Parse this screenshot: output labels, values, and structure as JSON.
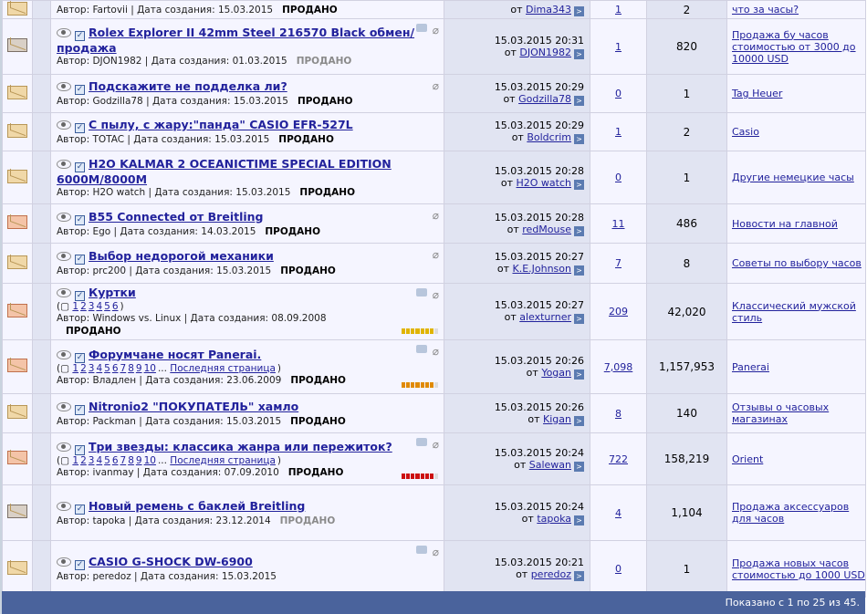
{
  "rows": [
    {
      "icon": "env",
      "title": "",
      "pages": null,
      "author": "Автор: Fartovii | Дата создания: 15.03.2015",
      "sold": "ПРОДАНО",
      "sold_grey": false,
      "date": "",
      "by": "от",
      "user": "Dima343",
      "replies": "1",
      "views": "2",
      "forum": "что за часы?",
      "h": 20,
      "rating": null
    },
    {
      "icon": "locked",
      "title": "Rolex Explorer II 42mm Steel 216570 Black обмен/продажа",
      "pages": null,
      "author": "Автор: DJON1982 | Дата создания: 01.03.2015",
      "sold": "ПРОДАНО",
      "sold_grey": true,
      "date": "15.03.2015 20:31",
      "by": "от",
      "user": "DJON1982",
      "replies": "1",
      "views": "820",
      "forum": "Продажа бу часов стоимостью от 3000 до 10000 USD",
      "h": 61,
      "rating": null,
      "tag": true
    },
    {
      "icon": "env",
      "title": "Подскажите не подделка ли?",
      "pages": null,
      "author": "Автор: Godzilla78 | Дата создания: 15.03.2015",
      "sold": "ПРОДАНО",
      "sold_grey": false,
      "date": "15.03.2015 20:29",
      "by": "от",
      "user": "Godzilla78",
      "replies": "0",
      "views": "1",
      "forum": "Tag Heuer",
      "h": 42,
      "rating": null
    },
    {
      "icon": "env",
      "title": "С пылу, с жару:\"панда\" CASIO EFR-527L",
      "pages": null,
      "author": "Автор: TOTAC | Дата создания: 15.03.2015",
      "sold": "ПРОДАНО",
      "sold_grey": false,
      "date": "15.03.2015 20:29",
      "by": "от",
      "user": "Boldcrim",
      "replies": "1",
      "views": "2",
      "forum": "Casio",
      "h": 42,
      "rating": null
    },
    {
      "icon": "env",
      "title": "H2O KALMAR 2 OCEANICTIME SPECIAL EDITION 6000M/8000M",
      "pages": null,
      "author": "Автор: H2O watch | Дата создания: 15.03.2015",
      "sold": "ПРОДАНО",
      "sold_grey": false,
      "date": "15.03.2015 20:28",
      "by": "от",
      "user": "H2O watch",
      "replies": "0",
      "views": "1",
      "forum": "Другие немецкие часы",
      "h": 58,
      "rating": null
    },
    {
      "icon": "hot",
      "title": "B55 Connected от Breitling",
      "pages": null,
      "author": "Автор: Ego | Дата создания: 14.03.2015",
      "sold": "ПРОДАНО",
      "sold_grey": false,
      "date": "15.03.2015 20:28",
      "by": "от",
      "user": "redMouse",
      "replies": "11",
      "views": "486",
      "forum": "Новости на главной",
      "h": 43,
      "rating": null
    },
    {
      "icon": "env",
      "title": "Выбор недорогой механики",
      "pages": null,
      "author": "Автор: prc200 | Дата создания: 15.03.2015",
      "sold": "ПРОДАНО",
      "sold_grey": false,
      "date": "15.03.2015 20:27",
      "by": "от",
      "user": "K.E.Johnson",
      "replies": "7",
      "views": "8",
      "forum": "Советы по выбору часов",
      "h": 44,
      "rating": null
    },
    {
      "icon": "hot",
      "title": "Куртки",
      "pages": [
        "1",
        "2",
        "3",
        "4",
        "5",
        "6"
      ],
      "pages_last": null,
      "author": "Автор: Windows vs. Linux | Дата создания: 08.09.2008",
      "sold": "ПРОДАНО",
      "sold_grey": false,
      "sold_newline": true,
      "date": "15.03.2015 20:27",
      "by": "от",
      "user": "alexturner",
      "replies": "209",
      "views": "42,020",
      "forum": "Классический мужской стиль",
      "h": 56,
      "rating": "yellow",
      "tag": true
    },
    {
      "icon": "hot",
      "title": "Форумчане носят Panerai.",
      "pages": [
        "1",
        "2",
        "3",
        "4",
        "5",
        "6",
        "7",
        "8",
        "9",
        "10"
      ],
      "pages_last": "Последняя страница",
      "author": "Автор: Владлен | Дата создания: 23.06.2009",
      "sold": "ПРОДАНО",
      "sold_grey": false,
      "date": "15.03.2015 20:26",
      "by": "от",
      "user": "Yogan",
      "replies": "7,098",
      "views": "1,157,953",
      "forum": "Panerai",
      "h": 59,
      "rating": "orange",
      "tag": true
    },
    {
      "icon": "env",
      "title": "Nitronio2 \"ПОКУПАТЕЛЬ\" хамло",
      "pages": null,
      "author": "Автор: Packman | Дата создания: 15.03.2015",
      "sold": "ПРОДАНО",
      "sold_grey": false,
      "date": "15.03.2015 20:26",
      "by": "от",
      "user": "Kigan",
      "replies": "8",
      "views": "140",
      "forum": "Отзывы о часовых магазинах",
      "h": 43,
      "rating": null
    },
    {
      "icon": "hot",
      "title": "Три звезды: классика жанра или пережиток?",
      "pages": [
        "1",
        "2",
        "3",
        "4",
        "5",
        "6",
        "7",
        "8",
        "9",
        "10"
      ],
      "pages_last": "Последняя страница",
      "author": "Автор: ivanmay | Дата создания: 07.09.2010",
      "sold": "ПРОДАНО",
      "sold_grey": false,
      "date": "15.03.2015 20:24",
      "by": "от",
      "user": "Salewan",
      "replies": "722",
      "views": "158,219",
      "forum": "Orient",
      "h": 57,
      "rating": "red",
      "tag": true
    },
    {
      "icon": "locked",
      "title": "Новый ремень с баклей Breitling",
      "pages": null,
      "author": "Автор: tapoka | Дата создания: 23.12.2014",
      "sold": "ПРОДАНО",
      "sold_grey": true,
      "date": "15.03.2015 20:24",
      "by": "от",
      "user": "tapoka",
      "replies": "4",
      "views": "1,104",
      "forum": "Продажа аксессуаров для часов",
      "h": 61,
      "rating": null
    },
    {
      "icon": "env",
      "title": "CASIO G-SHOCK DW-6900",
      "pages": null,
      "author": "Автор: peredoz | Дата создания: 15.03.2015",
      "sold": "",
      "sold_grey": false,
      "date": "15.03.2015 20:21",
      "by": "от",
      "user": "peredoz",
      "replies": "0",
      "views": "1",
      "forum": "Продажа новых часов стоимостью до 1000 USD",
      "h": 62,
      "rating": null,
      "tag": true
    }
  ],
  "footer": {
    "text": "Показано с 1 по 25 из 45."
  },
  "colors": {
    "yellow": "#e0b400",
    "orange": "#e08a00",
    "red": "#cc1010"
  }
}
